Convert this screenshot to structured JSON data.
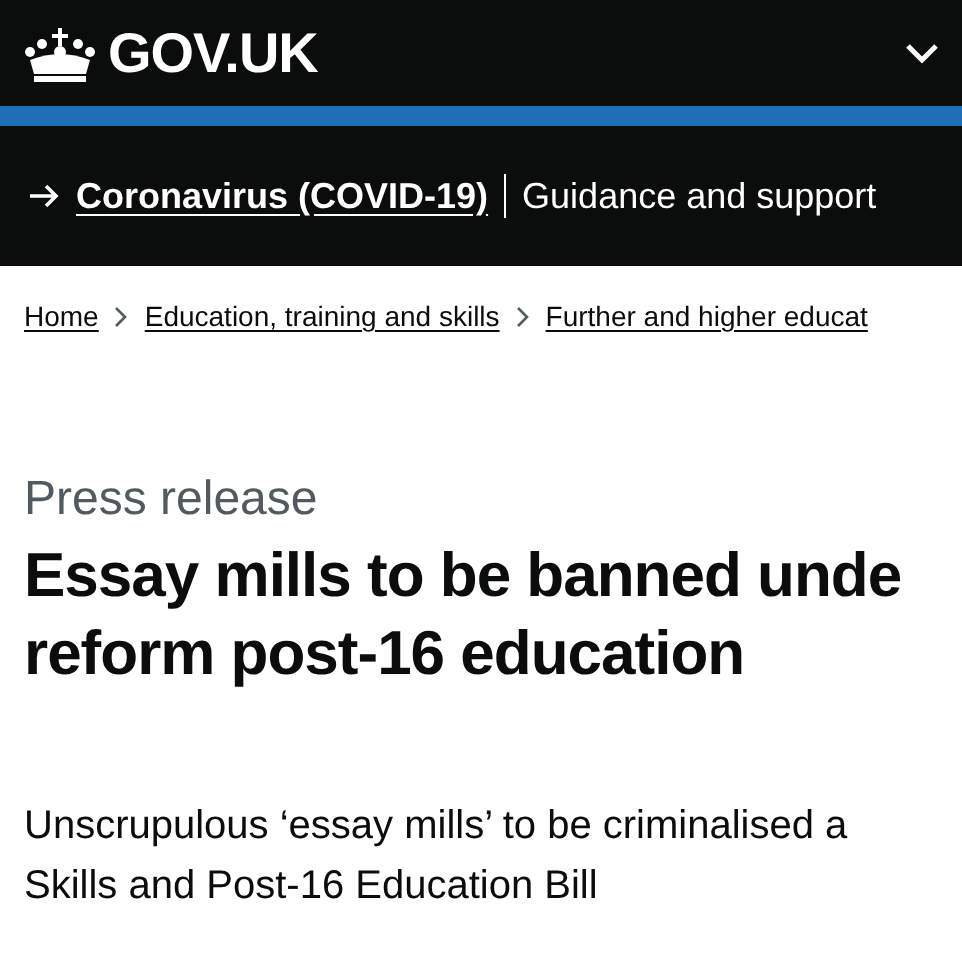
{
  "header": {
    "logo": "GOV.UK",
    "menu_expanded": false
  },
  "banner": {
    "link": "Coronavirus (COVID-19)",
    "text": "Guidance and support"
  },
  "breadcrumbs": [
    "Home",
    "Education, training and skills",
    "Further and higher educat"
  ],
  "page": {
    "type": "Press release",
    "title_lines": [
      "Essay mills to be banned unde",
      "reform post-16 education"
    ],
    "summary_lines": [
      "Unscrupulous ‘essay mills’ to be criminalised a",
      "Skills and Post-16 Education Bill"
    ]
  }
}
